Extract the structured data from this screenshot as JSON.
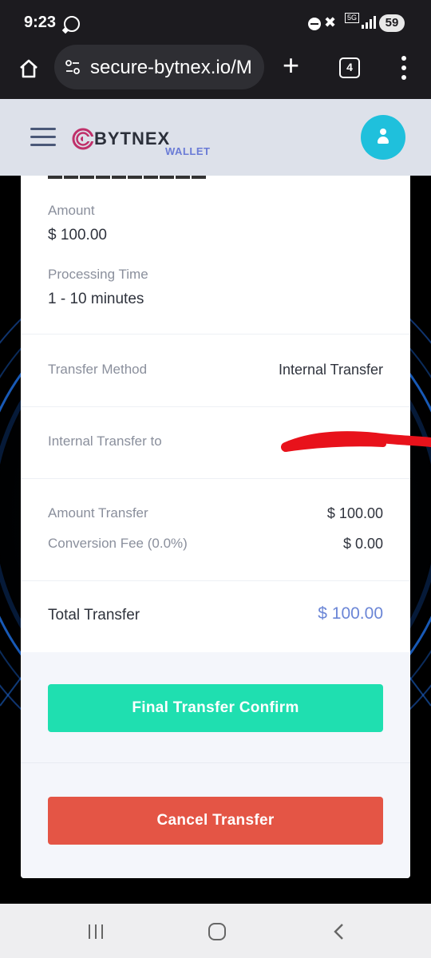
{
  "status_bar": {
    "time": "9:23",
    "network_label": "5G",
    "battery": "59",
    "icons": [
      "whatsapp-icon",
      "dnd-icon",
      "mute-icon",
      "signal-icon"
    ]
  },
  "browser": {
    "url": "secure-bytnex.io/M",
    "tab_count": "4",
    "icons": [
      "home-icon",
      "tune-icon",
      "plus-icon",
      "tabs-icon",
      "menu-icon"
    ]
  },
  "header": {
    "logo_text": "BYTNEX",
    "logo_sub": "WALLET",
    "accent": "#1fc0dc",
    "logo_color": "#c0306a"
  },
  "details": {
    "amount_label": "Amount",
    "amount_value": "$ 100.00",
    "processing_label": "Processing Time",
    "processing_value": "1 - 10 minutes",
    "method_label": "Transfer Method",
    "method_value": "Internal Transfer",
    "to_label": "Internal Transfer to",
    "amount_transfer_label": "Amount Transfer",
    "amount_transfer_value": "$ 100.00",
    "fee_label": "Conversion Fee (0.0%)",
    "fee_value": "$ 0.00",
    "total_label": "Total Transfer",
    "total_value": "$ 100.00",
    "total_color": "#6b86d6"
  },
  "actions": {
    "confirm_label": "Final Transfer Confirm",
    "cancel_label": "Cancel Transfer",
    "confirm_color": "#1fdfb0",
    "cancel_color": "#e45545"
  },
  "nav_bar": {
    "icons": [
      "recents-icon",
      "home-nav-icon",
      "back-icon"
    ]
  }
}
